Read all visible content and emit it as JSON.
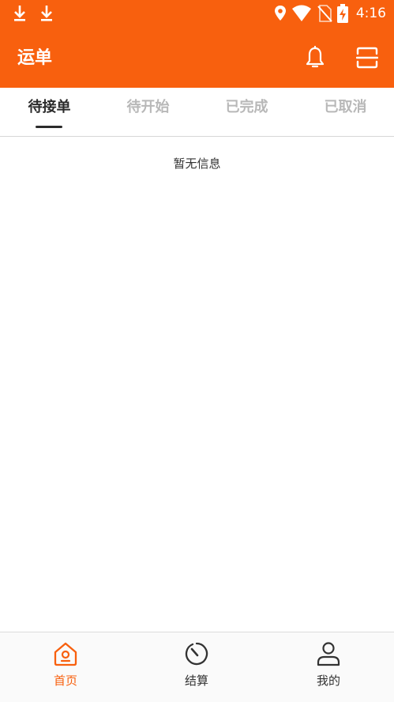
{
  "colors": {
    "accent": "#f8600e",
    "active_text": "#2b2b2b",
    "inactive_text": "#b8b8b8"
  },
  "statusbar": {
    "time": "4:16",
    "icons": [
      "download-icon",
      "download-icon",
      "location-icon",
      "wifi-icon",
      "no-sim-icon",
      "battery-charging-icon"
    ]
  },
  "header": {
    "title": "运单",
    "icons": [
      "bell-icon",
      "scan-icon"
    ]
  },
  "tabs": [
    {
      "label": "待接单",
      "active": true
    },
    {
      "label": "待开始",
      "active": false
    },
    {
      "label": "已完成",
      "active": false
    },
    {
      "label": "已取消",
      "active": false
    }
  ],
  "main": {
    "empty_text": "暂无信息"
  },
  "bottom_nav": [
    {
      "label": "首页",
      "icon": "home-icon",
      "active": true
    },
    {
      "label": "结算",
      "icon": "timer-icon",
      "active": false
    },
    {
      "label": "我的",
      "icon": "person-icon",
      "active": false
    }
  ]
}
